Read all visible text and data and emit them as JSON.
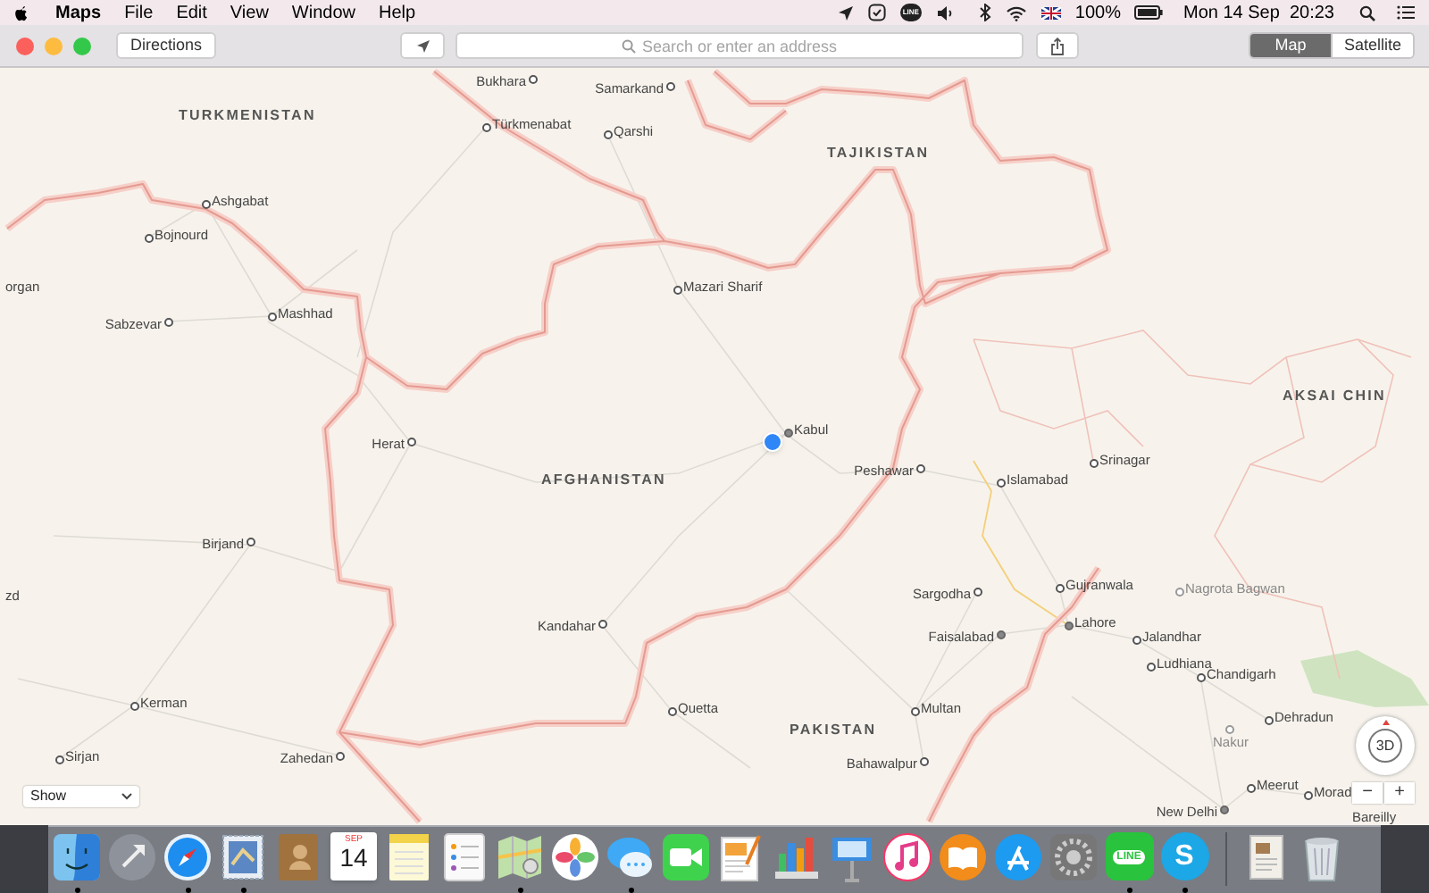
{
  "menu_bar": {
    "app": "Maps",
    "menus": [
      "File",
      "Edit",
      "View",
      "Window",
      "Help"
    ],
    "line_glyph": "LINE",
    "battery": "100%",
    "clock": "Mon 14 Sep  20:23"
  },
  "toolbar": {
    "directions": "Directions",
    "search": {
      "placeholder": "Search or enter an address"
    },
    "map_types": [
      {
        "label": "Map",
        "selected": true
      },
      {
        "label": "Satellite",
        "selected": false
      }
    ]
  },
  "map": {
    "countries": [
      "TURKMENISTAN",
      "TAJIKISTAN",
      "AFGHANISTAN",
      "AKSAI CHIN",
      "PAKISTAN"
    ],
    "places": [
      {
        "name": "Bukhara",
        "kind": "city"
      },
      {
        "name": "Samarkand",
        "kind": "city"
      },
      {
        "name": "Türkmenabat",
        "kind": "city"
      },
      {
        "name": "Qarshi",
        "kind": "city"
      },
      {
        "name": "Ashgabat",
        "kind": "city"
      },
      {
        "name": "Bojnourd",
        "kind": "city"
      },
      {
        "name": "organ",
        "kind": "city"
      },
      {
        "name": "Mashhad",
        "kind": "city"
      },
      {
        "name": "Sabzevar",
        "kind": "city"
      },
      {
        "name": "Mazari Sharif",
        "kind": "city"
      },
      {
        "name": "Herat",
        "kind": "city"
      },
      {
        "name": "Kabul",
        "kind": "capital"
      },
      {
        "name": "Peshawar",
        "kind": "city"
      },
      {
        "name": "Islamabad",
        "kind": "city"
      },
      {
        "name": "Srinagar",
        "kind": "city"
      },
      {
        "name": "Birjand",
        "kind": "city"
      },
      {
        "name": "zd",
        "kind": "city"
      },
      {
        "name": "Kandahar",
        "kind": "city"
      },
      {
        "name": "Sargodha",
        "kind": "city"
      },
      {
        "name": "Gujranwala",
        "kind": "city"
      },
      {
        "name": "Nagrota Bagwan",
        "kind": "town"
      },
      {
        "name": "Faisalabad",
        "kind": "capital"
      },
      {
        "name": "Lahore",
        "kind": "capital"
      },
      {
        "name": "Jalandhar",
        "kind": "city"
      },
      {
        "name": "Ludhiana",
        "kind": "city"
      },
      {
        "name": "Chandigarh",
        "kind": "city"
      },
      {
        "name": "Kerman",
        "kind": "city"
      },
      {
        "name": "Quetta",
        "kind": "city"
      },
      {
        "name": "Multan",
        "kind": "city"
      },
      {
        "name": "Dehradun",
        "kind": "city"
      },
      {
        "name": "Nakur",
        "kind": "town"
      },
      {
        "name": "Sirjan",
        "kind": "city"
      },
      {
        "name": "Zahedan",
        "kind": "city"
      },
      {
        "name": "Bahawalpur",
        "kind": "city"
      },
      {
        "name": "Meerut",
        "kind": "city"
      },
      {
        "name": "Morad",
        "kind": "city"
      },
      {
        "name": "New Delhi",
        "kind": "capital"
      },
      {
        "name": "Bareilly",
        "kind": "city"
      }
    ],
    "show_menu": "Show",
    "compass": "3D",
    "zoom_out": "−",
    "zoom_in": "+"
  },
  "dock": {
    "items": [
      {
        "kind": "finder",
        "running": true
      },
      {
        "kind": "launchpad",
        "running": false
      },
      {
        "kind": "safari",
        "running": true
      },
      {
        "kind": "mail",
        "running": true
      },
      {
        "kind": "contacts",
        "running": false
      },
      {
        "kind": "calendar",
        "running": false,
        "month": "SEP",
        "day": "14"
      },
      {
        "kind": "notes",
        "running": false
      },
      {
        "kind": "reminders",
        "running": false
      },
      {
        "kind": "maps",
        "running": true
      },
      {
        "kind": "photos",
        "running": false
      },
      {
        "kind": "messages",
        "running": true
      },
      {
        "kind": "facetime",
        "running": false
      },
      {
        "kind": "pages",
        "running": false
      },
      {
        "kind": "numbers",
        "running": false
      },
      {
        "kind": "keynote",
        "running": false
      },
      {
        "kind": "music",
        "running": false
      },
      {
        "kind": "books",
        "running": false
      },
      {
        "kind": "appstore",
        "running": false
      },
      {
        "kind": "settings",
        "running": false
      },
      {
        "kind": "line",
        "running": true,
        "glyph": "LINE"
      },
      {
        "kind": "skype",
        "running": true,
        "glyph": "S"
      },
      {
        "kind": "separator"
      },
      {
        "kind": "document",
        "running": false
      },
      {
        "kind": "trash",
        "running": false
      }
    ]
  }
}
